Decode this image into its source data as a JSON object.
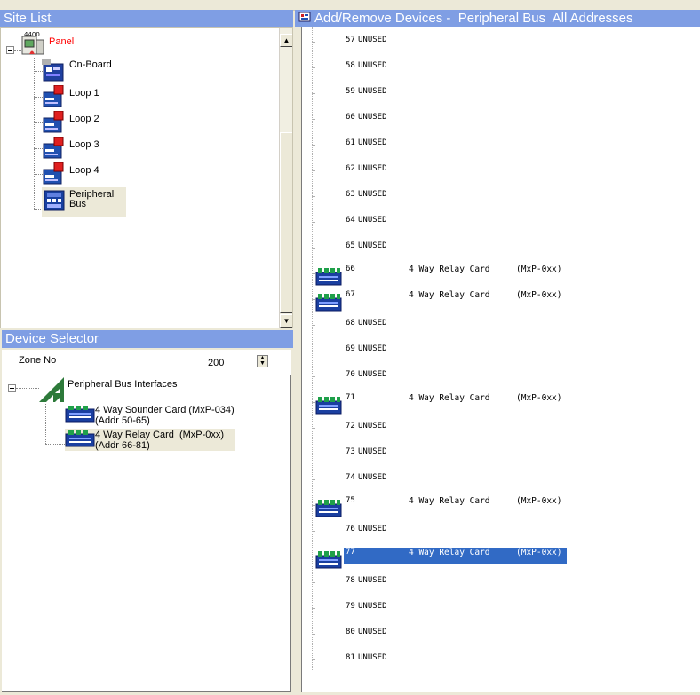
{
  "site_list": {
    "header": "Site List",
    "root": {
      "badge": "4400",
      "label": "Panel",
      "label_color": "#ff0000"
    },
    "children": [
      {
        "label": "On-Board",
        "icon": "board-icon"
      },
      {
        "label": "Loop 1",
        "icon": "loop-icon"
      },
      {
        "label": "Loop 2",
        "icon": "loop-icon"
      },
      {
        "label": "Loop 3",
        "icon": "loop-icon"
      },
      {
        "label": "Loop 4",
        "icon": "loop-icon"
      },
      {
        "label_line1": "Peripheral",
        "label_line2": "Bus",
        "icon": "peripheral-bus-icon",
        "selected": true
      }
    ]
  },
  "device_selector": {
    "header": "Device Selector",
    "zone_label": "Zone No",
    "zone_value": "200",
    "root_label": "Peripheral Bus Interfaces",
    "items": [
      {
        "line1": "4 Way Sounder Card (MxP-034)",
        "line2": "(Addr 50-65)"
      },
      {
        "line1": "4 Way Relay Card  (MxP-0xx)",
        "line2": "(Addr 66-81)",
        "selected": true
      }
    ]
  },
  "devices": {
    "header": "Add/Remove Devices -  Peripheral Bus  All Addresses",
    "rows": [
      {
        "num": "57",
        "status": "UNUSED"
      },
      {
        "num": "58",
        "status": "UNUSED"
      },
      {
        "num": "59",
        "status": "UNUSED"
      },
      {
        "num": "60",
        "status": "UNUSED"
      },
      {
        "num": "61",
        "status": "UNUSED"
      },
      {
        "num": "62",
        "status": "UNUSED"
      },
      {
        "num": "63",
        "status": "UNUSED"
      },
      {
        "num": "64",
        "status": "UNUSED"
      },
      {
        "num": "65",
        "status": "UNUSED"
      },
      {
        "num": "66",
        "name": "4 Way Relay Card",
        "code": "(MxP-0xx)"
      },
      {
        "num": "67",
        "name": "4 Way Relay Card",
        "code": "(MxP-0xx)"
      },
      {
        "num": "68",
        "status": "UNUSED"
      },
      {
        "num": "69",
        "status": "UNUSED"
      },
      {
        "num": "70",
        "status": "UNUSED"
      },
      {
        "num": "71",
        "name": "4 Way Relay Card",
        "code": "(MxP-0xx)"
      },
      {
        "num": "72",
        "status": "UNUSED"
      },
      {
        "num": "73",
        "status": "UNUSED"
      },
      {
        "num": "74",
        "status": "UNUSED"
      },
      {
        "num": "75",
        "name": "4 Way Relay Card",
        "code": "(MxP-0xx)"
      },
      {
        "num": "76",
        "status": "UNUSED"
      },
      {
        "num": "77",
        "name": "4 Way Relay Card",
        "code": "(MxP-0xx)",
        "selected": true
      },
      {
        "num": "78",
        "status": "UNUSED"
      },
      {
        "num": "79",
        "status": "UNUSED"
      },
      {
        "num": "80",
        "status": "UNUSED"
      },
      {
        "num": "81",
        "status": "UNUSED"
      }
    ]
  },
  "colors": {
    "header": "#7f9ee4",
    "selection": "#316ac5",
    "tree_selected": "#ece9d8"
  }
}
